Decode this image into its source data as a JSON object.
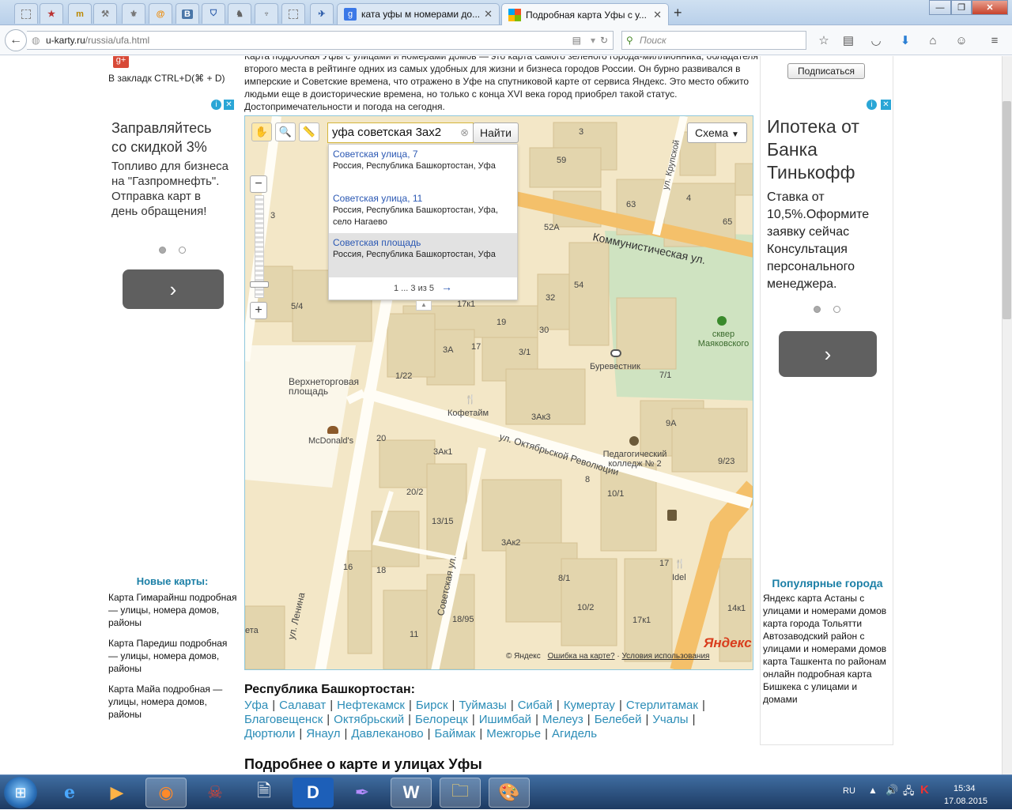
{
  "browser": {
    "tabs": [
      {
        "title": "ката уфы м номерами до..."
      },
      {
        "title": "Подробная карта Уфы с у..."
      }
    ],
    "new_tab": "+",
    "url_host": "u-karty.ru",
    "url_path": "/russia/ufa.html",
    "search_placeholder": "Поиск"
  },
  "left": {
    "bookmark_text": "В закладк CTRL+D(⌘ + D)",
    "ad": {
      "headline": "Заправляйтесь со скидкой 3%",
      "body": "Топливо для бизнеса на \"Газпромнефть\". Отправка карт в день обращения!"
    },
    "new_maps_title": "Новые карты:",
    "new_maps": [
      "Карта Гимарайнш подробная — улицы, номера домов, районы",
      "Карта Паредиш подробная — улицы, номера домов, районы",
      "Карта Майа подробная — улицы, номера домов, районы"
    ]
  },
  "intro_text": "Карта подробная Уфы с улицами и номерами домов — это карта самого зеленого города-миллионника, обладателя второго места в рейтинге одних из самых удобных для жизни и бизнеса городов России.  Он бурно развивался в имперские и Советские времена, что отражено в Уфе на спутниковой карте от сервиса Яндекс. Это место обжито людьми еще в доисторические времена, но только с конца XVI века город приобрел такой статус. Достопримечательности и погода на сегодня.",
  "right": {
    "subscribe_label": "Подписаться",
    "ad": {
      "headline": "Ипотека от Банка Тинькофф",
      "body": "Ставка от 10,5%.Оформите заявку сейчас Консультация персонального менеджера."
    },
    "popular_title": "Популярные города",
    "popular_text": "Яндекс карта Астаны с улицами и номерами домов карта города Тольятти Автозаводский район с улицами и номерами домов карта Ташкента по районам онлайн подробная карта Бишкека с улицами и домами"
  },
  "map": {
    "search_value": "уфа советская 3ах2",
    "find_label": "Найти",
    "schema_label": "Схема",
    "suggestions": [
      {
        "title": "Советская улица, 7",
        "addr": "Россия, Республика Башкортостан, Уфа"
      },
      {
        "title": "Советская улица, 11",
        "addr": "Россия, Республика Башкортостан, Уфа, село Нагаево"
      },
      {
        "title": "Советская площадь",
        "addr": "Россия, Республика Башкортостан, Уфа"
      }
    ],
    "pager": "1 ... 3 из 5",
    "zoom_level": 0.1,
    "labels": {
      "street1": "Коммунистическая ул.",
      "street2": "ул. Октябрьской Революции",
      "street3": "ул. Ленина",
      "street4": "Советская ул.",
      "street5": "ул. Крупской",
      "square": "Верхнеторговая площадь",
      "mcd": "McDonald's",
      "cafe": "Кофетайм",
      "cinema": "Буревестник",
      "park": "сквер Маяковского",
      "college": "Педагогический колледж № 2",
      "idel": "Idel",
      "eta": "ета"
    },
    "house_numbers": [
      "3",
      "59",
      "4",
      "63",
      "65",
      "52А",
      "3",
      "54",
      "32",
      "5/4",
      "17к1",
      "19",
      "30",
      "3А",
      "17",
      "3/1",
      "7/1",
      "1/22",
      "3Ак3",
      "9А",
      "20",
      "3Ак1",
      "8",
      "10/1",
      "9/23",
      "20/2",
      "13/15",
      "3Ак2",
      "16",
      "18",
      "8/1",
      "17",
      "10/2",
      "14к1",
      "18/95",
      "11",
      "17к1"
    ],
    "copyright": "© Яндекс",
    "error_link": "Ошибка на карте?",
    "terms_link": "Условия использования",
    "logo": "Яндекс"
  },
  "region": {
    "title": "Республика Башкортостан:",
    "cities": [
      "Уфа",
      "Салават",
      "Нефтекамск",
      "Бирск",
      "Туймазы",
      "Сибай",
      "Кумертау",
      "Стерлитамак",
      "Благовещенск",
      "Октябрьский",
      "Белорецк",
      "Ишимбай",
      "Мелеуз",
      "Белебей",
      "Учалы",
      "Дюртюли",
      "Янаул",
      "Давлеканово",
      "Баймак",
      "Межгорье",
      "Агидель"
    ]
  },
  "more_title": "Подробнее о карте и улицах Уфы",
  "tray": {
    "lang": "RU",
    "time": "15:34",
    "date": "17.08.2015"
  }
}
